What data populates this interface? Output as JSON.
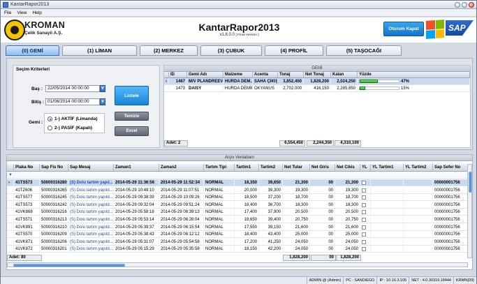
{
  "window": {
    "title": "KantarRapor2013"
  },
  "menu": {
    "items": [
      "File",
      "View",
      "Help"
    ]
  },
  "header": {
    "brand": "KROMAN",
    "brand_sub": "Çelik Sanayii A.Ş.",
    "app_title": "KantarRapor2013",
    "version": "v1.8.0.0",
    "version_tag": "[ Final Version ]",
    "logout": "Oturum Kapat",
    "sap": "SAP"
  },
  "tabs": [
    "(0) GEMİ",
    "(1) LİMAN",
    "(2) MERKEZ",
    "(3) ÇUBUK",
    "(4) PROFİL",
    "(5) TAŞOCAĞI"
  ],
  "filters": {
    "title": "Seçim Kriterleri",
    "start_label": "Baş :",
    "start_value": "22/05/2014 00:00:00",
    "end_label": "Bitiş :",
    "end_value": "01/06/2014 00:00:00",
    "ship_label": "Gemi :",
    "radio1": "1-) AKTİF (Limanda)",
    "radio2": "2-) PASİF (Kapalı)",
    "list_button": "Listele",
    "clear_button": "Temizle",
    "excel_button": "Excel"
  },
  "gemi": {
    "title": "GEMİ",
    "columns": [
      "ID",
      "Gemi Adı",
      "Malzeme",
      "Acenta",
      "Tonaj",
      "Net Tonaj",
      "Kalan",
      "Yüzde"
    ],
    "rows": [
      {
        "id": "1467",
        "name": "M/V PLANDREEV",
        "mal": "HURDA DEM...",
        "acenta": "SAHA ÇIKIŞ",
        "tonaj": "3,852,450",
        "net": "1,828,200",
        "kalan": "2,024,250",
        "pct": 47,
        "pct_text": "47%"
      },
      {
        "id": "1473",
        "name": "DAISY",
        "mal": "HURDA DEMİR",
        "acenta": "OKYANUS",
        "tonaj": "2,702,000",
        "net": "416,150",
        "kalan": "2,285,850",
        "pct": 15,
        "pct_text": "15%"
      }
    ],
    "footer_count": "Adet: 2",
    "footer_tonaj": "6,554,450",
    "footer_net": "2,244,350",
    "footer_kalan": "4,310,100"
  },
  "arsiv": {
    "title": "Arşiv Veritabanı",
    "columns": [
      "Plaka No",
      "Sap Fis No",
      "Sap Mesaj",
      "Zaman1",
      "Zaman2",
      "Tartım Tipi",
      "Tartim1",
      "Tartim2",
      "Net Tutar",
      "Net Giris",
      "Net Cikis",
      "YL",
      "YL Tartim1",
      "YL Tartim2",
      "Sap Sefer No"
    ],
    "rows": [
      [
        "41TS573",
        "50000316280",
        "(S) Dolu tartım yapıl...",
        "2014-05-29 11:36:56",
        "2014-05-29 11:52:34",
        "NORMAL",
        "18,350",
        "39,650",
        "21,300",
        "00",
        "21,300",
        "",
        "",
        "",
        "00000001756"
      ],
      [
        "41TZ606",
        "50000316265",
        "(S) Dolu tartım yapıld...",
        "2014-05-29 10:49:10",
        "2014-05-29 11:07:51",
        "NORMAL",
        "20,000",
        "39,300",
        "19,300",
        "00",
        "19,300",
        "",
        "",
        "",
        "00000001756"
      ],
      [
        "41TS577",
        "50000316245",
        "(S) Dolu tartım yapıld...",
        "2014-05-29 09:38:39",
        "2014-05-29 10:09:26",
        "NORMAL",
        "18,500",
        "37,200",
        "18,700",
        "00",
        "18,700",
        "",
        "",
        "",
        "00000001756"
      ],
      [
        "41TS573",
        "50000316242",
        "(S) Dolu tartım yapıld...",
        "2014-05-29 09:32:04",
        "2014-05-29 09:51:24",
        "NORMAL",
        "18,400",
        "36,700",
        "18,300",
        "00",
        "18,300",
        "",
        "",
        "",
        "00000001756"
      ],
      [
        "41VK868",
        "50000316216",
        "(S) Dolu tartım yapıld...",
        "2014-05-29 05:58:18",
        "2014-05-29 06:39:13",
        "NORMAL",
        "17,400",
        "37,900",
        "20,500",
        "00",
        "20,500",
        "",
        "",
        "",
        "00000001756"
      ],
      [
        "41TS571",
        "50000316213",
        "(S) Dolu tartım yapıld...",
        "2014-05-29 05:53:14",
        "2014-05-29 06:28:04",
        "NORMAL",
        "18,650",
        "39,400",
        "20,750",
        "00",
        "20,750",
        "",
        "",
        "",
        "00000001756"
      ],
      [
        "41VK891",
        "50000316210",
        "(S) Dolu tartım yapıld...",
        "2014-05-29 05:39:37",
        "2014-05-29 06:15:54",
        "NORMAL",
        "17,550",
        "39,150",
        "21,600",
        "00",
        "21,600",
        "",
        "",
        "",
        "00000001756"
      ],
      [
        "41TS570",
        "50000316209",
        "(S) Dolu tartım yapıld...",
        "2014-05-29 05:38:43",
        "2014-05-29 06:12:12",
        "NORMAL",
        "18,400",
        "43,400",
        "25,000",
        "00",
        "25,000",
        "",
        "",
        "",
        "00000001756"
      ],
      [
        "41VK871",
        "50000316206",
        "(S) Dolu tartım yapıld...",
        "2014-05-29 05:31:07",
        "2014-05-29 05:54:58",
        "NORMAL",
        "17,200",
        "41,250",
        "24,050",
        "00",
        "24,050",
        "",
        "",
        "",
        "00000001756"
      ],
      [
        "41VK872",
        "50000316201",
        "(S) Dolu tartım yapıld...",
        "2014-05-29 05:15:29",
        "2014-05-29 05:35:58",
        "NORMAL",
        "18,150",
        "42,200",
        "24,050",
        "00",
        "24,050",
        "",
        "",
        "",
        "00000001756"
      ]
    ],
    "footer_count": "Adet: 80",
    "footer_net": "1,828,200",
    "footer_giris": "00",
    "footer_cikis": "1,828,200"
  },
  "status": {
    "user": "ADMIN @ (Admin)",
    "pc": "PC : SANDIEGO",
    "ip": "IP : 10.16.3.105",
    "net": "NET : 4.0.30319.18444",
    "code": "KRMN{09}"
  },
  "colors": {
    "accent": "#1886dc",
    "selection": "#c9d9f4",
    "progress": "#26a81a"
  }
}
